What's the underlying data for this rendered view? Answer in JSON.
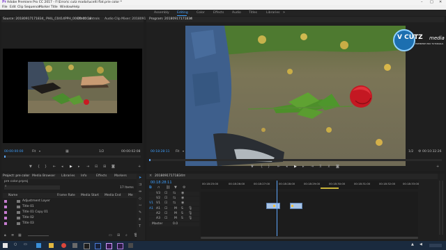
{
  "window_title": "Adobe Premiere Pro CC 2017 - F:\\Error\\c cutz madai\\ucelti flat.prie color *",
  "menu": [
    "File",
    "Edit",
    "Clip",
    "Sequence",
    "Marker",
    "Title",
    "Window",
    "Help"
  ],
  "workspaces": [
    "Assembly",
    "Editing",
    "Color",
    "Effects",
    "Audio",
    "Titles",
    "Libraries"
  ],
  "active_workspace": "Editing",
  "source": {
    "tabs": [
      "Source: 20180917171834_ PHIL_C0414PPH_00:00:00:18",
      "Effect Controls",
      "Audio Clip Mixer: 20180917"
    ],
    "timecode_left": "00:00:00:00",
    "fit": "Fit",
    "fraction": "1/2",
    "timecode_right": "00:00:02:08"
  },
  "program": {
    "tab": "Program: 20180917171834",
    "timecode_left": "00:18:28:11",
    "fit": "Fit",
    "fraction": "1/2",
    "timecode_right": "00:10:32:26"
  },
  "watermark": {
    "brand": "V CUTZ",
    "sub": "media",
    "tagline": "PREMIERE PRO TUTORIALS"
  },
  "project": {
    "tabs": [
      "Project: pre color",
      "Media Browser",
      "Libraries",
      "Info",
      "Effects",
      "Markers"
    ],
    "file": "pre color.prproj",
    "count": "17 Items",
    "columns": [
      "Name",
      "Frame Rate",
      "Media Start",
      "Media End",
      "Me"
    ],
    "items": [
      "Adjustment Layer",
      "Title 01",
      "Title 01 Copy 01",
      "Title 02",
      "Title 03"
    ]
  },
  "timeline": {
    "tab": "20180917171834",
    "timecode": "00:18:28:11",
    "ruler": [
      "00:18:25:00",
      "00:18:26:00",
      "00:18:27:00",
      "00:18:28:00",
      "00:18:29:00",
      "00:18:30:00",
      "00:18:31:00",
      "00:18:32:00",
      "00:18:33:00"
    ],
    "video_tracks": [
      "V3",
      "V2",
      "V1"
    ],
    "audio_tracks": [
      "A1",
      "A2",
      "A3"
    ],
    "master": "Master",
    "master_value": "0.0"
  },
  "colors": {
    "accent": "#3ea0ff",
    "clip": "#a8c4e6",
    "playhead": "#5fa8ff"
  }
}
